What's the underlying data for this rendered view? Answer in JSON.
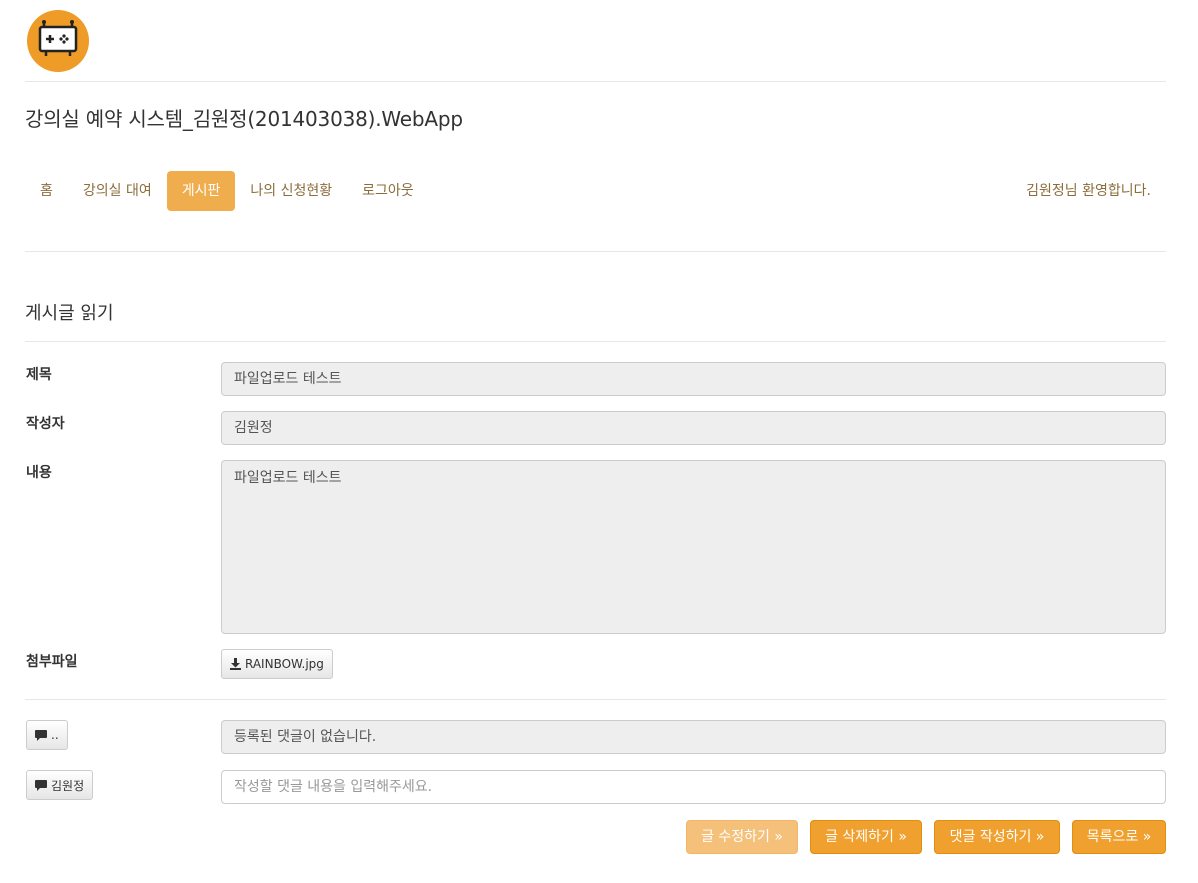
{
  "brand": {
    "logo_icon": "game-controller-board-icon",
    "accent": "#ee9b27"
  },
  "app_title": "강의실 예약 시스템_김원정(201403038).WebApp",
  "nav": {
    "items": [
      {
        "label": "홈",
        "active": false
      },
      {
        "label": "강의실 대여",
        "active": false
      },
      {
        "label": "게시판",
        "active": true
      },
      {
        "label": "나의 신청현황",
        "active": false
      },
      {
        "label": "로그아웃",
        "active": false
      }
    ],
    "welcome": "김원정님 환영합니다."
  },
  "post": {
    "section_title": "게시글 읽기",
    "title_label": "제목",
    "title_value": "파일업로드 테스트",
    "author_label": "작성자",
    "author_value": "김원정",
    "content_label": "내용",
    "content_value": "파일업로드 테스트",
    "attachment_label": "첨부파일",
    "attachment_name": "RAINBOW.jpg",
    "attachment_icon": "download-icon"
  },
  "comments": {
    "toggle_label": "..",
    "comment_icon": "comment-icon",
    "empty_message": "등록된 댓글이 없습니다.",
    "author_label": "김원정",
    "input_placeholder": "작성할 댓글 내용을 입력해주세요."
  },
  "actions": {
    "edit": "글 수정하기 »",
    "delete": "글 삭제하기 »",
    "comment": "댓글 작성하기 »",
    "list": "목록으로 »"
  }
}
